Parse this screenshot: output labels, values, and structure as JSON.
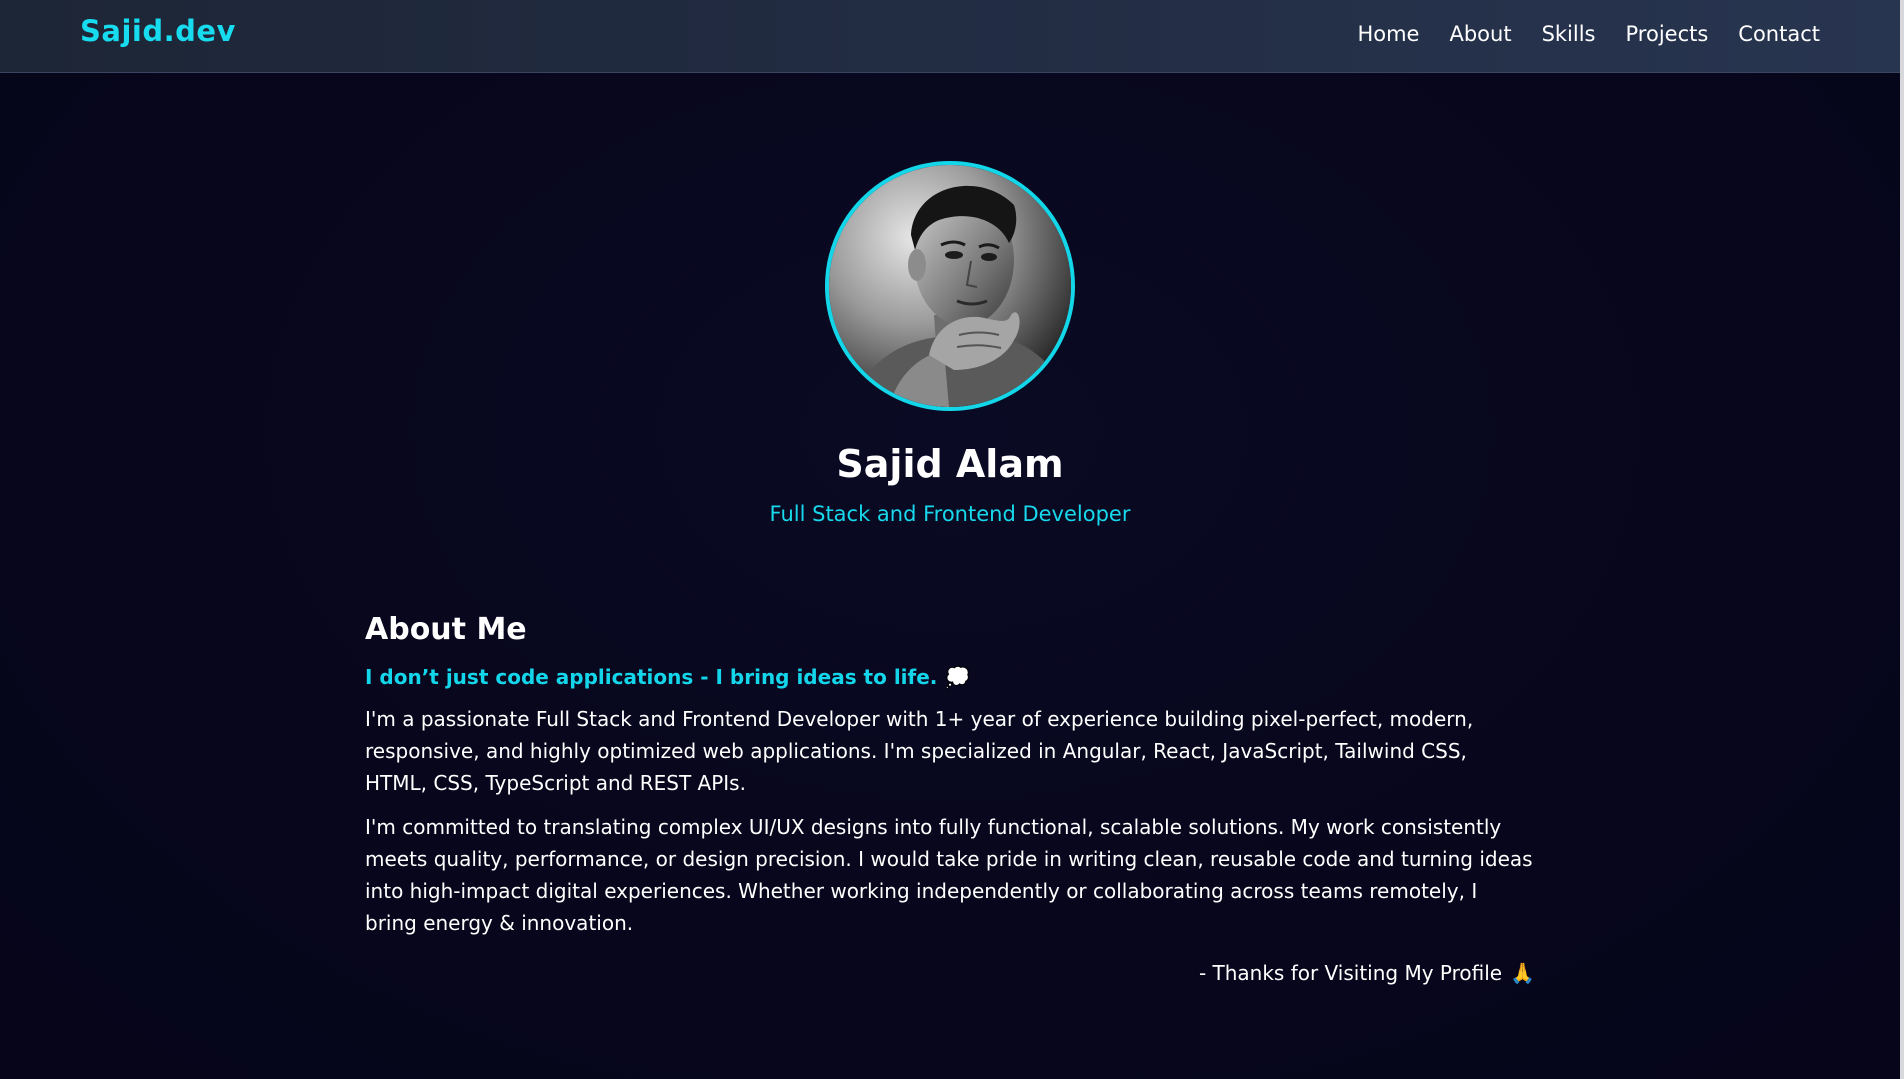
{
  "navbar": {
    "brand": "Sajid.dev",
    "links": [
      "Home",
      "About",
      "Skills",
      "Projects",
      "Contact"
    ]
  },
  "hero": {
    "name": "Sajid Alam",
    "role": "Full Stack and Frontend Developer",
    "avatar_icon": "profile-photo"
  },
  "about": {
    "title": "About Me",
    "tagline": "I don’t just code applications - I bring ideas to life.",
    "tagline_emoji": "💭",
    "paragraph1": "I'm a passionate Full Stack and Frontend Developer with 1+ year of experience building pixel-perfect, modern, responsive, and highly optimized web applications. I'm specialized in Angular, React, JavaScript, Tailwind CSS, HTML, CSS, TypeScript and REST APIs.",
    "paragraph2": "I'm committed to translating complex UI/UX designs into fully functional, scalable solutions. My work consistently meets quality, performance, or design precision. I would take pride in writing clean, reusable code and turning ideas into high-impact digital experiences. Whether working independently or collaborating across teams remotely, I bring energy & innovation.",
    "thanks": "- Thanks for Visiting My Profile",
    "thanks_emoji": "🙏"
  },
  "colors": {
    "accent": "#17dcef",
    "background": "#07061d",
    "navbar": "#222c43"
  }
}
